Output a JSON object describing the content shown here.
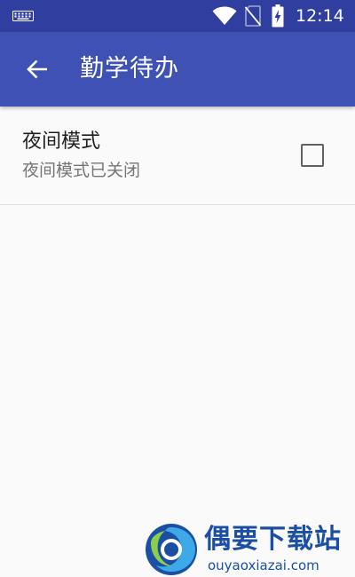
{
  "status_bar": {
    "time": "12:14",
    "icons": [
      "keyboard-icon",
      "wifi-icon",
      "no-sim-icon",
      "battery-charging-icon"
    ]
  },
  "app_bar": {
    "title": "勤学待办",
    "back_icon": "arrow-left-icon"
  },
  "preference": {
    "title": "夜间模式",
    "summary": "夜间模式已关闭",
    "checked": false
  },
  "watermark": {
    "title": "偶要下载站",
    "url": "ouyaoxiazai.com"
  },
  "colors": {
    "status_bar": "#303f9f",
    "app_bar": "#3f51b5",
    "background": "#fafafa",
    "title_text": "#212121",
    "summary_text": "#757575",
    "watermark": "#1a4fa3"
  }
}
